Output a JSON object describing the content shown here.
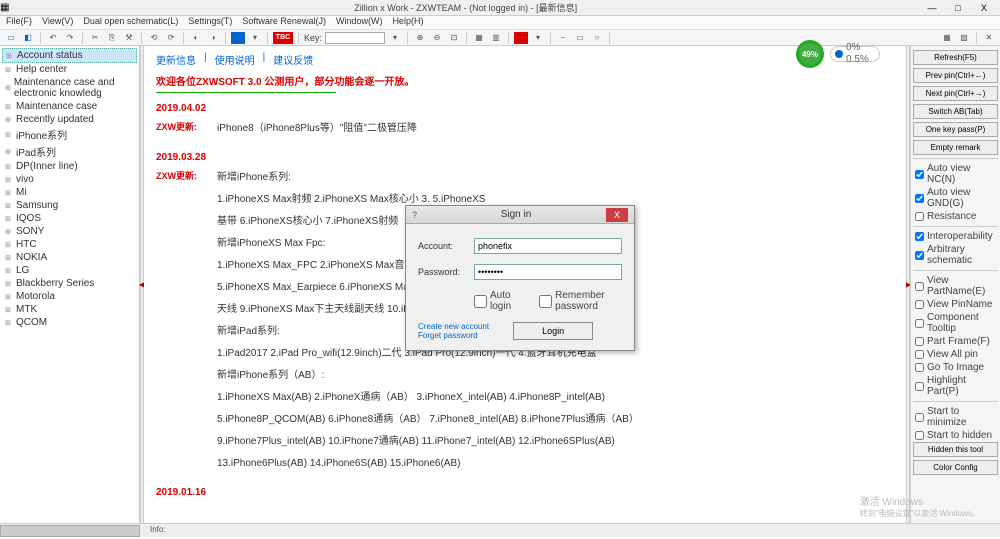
{
  "window": {
    "title": "Zillion x Work - ZXWTEAM - (Not logged in) - [最新信息]",
    "min": "—",
    "max": "□",
    "close": "X"
  },
  "menubar": [
    "File(F)",
    "View(V)",
    "Dual open schematic(L)",
    "Settings(T)",
    "Software Renewal(J)",
    "Window(W)",
    "Help(H)"
  ],
  "toolbar": {
    "key_label": "Key:",
    "tbc": "TBC"
  },
  "sidebar": {
    "items": [
      {
        "label": "Account status",
        "active": true
      },
      {
        "label": "Help center"
      },
      {
        "label": "Maintenance case and electronic knowledg"
      },
      {
        "label": "Maintenance case"
      },
      {
        "label": "Recently updated"
      },
      {
        "label": "iPhone系列"
      },
      {
        "label": "iPad系列"
      },
      {
        "label": "DP(Inner line)"
      },
      {
        "label": "vivo"
      },
      {
        "label": "Mi"
      },
      {
        "label": "Samsung"
      },
      {
        "label": "IQOS"
      },
      {
        "label": "SONY"
      },
      {
        "label": "HTC"
      },
      {
        "label": "NOKIA"
      },
      {
        "label": "LG"
      },
      {
        "label": "Blackberry Series"
      },
      {
        "label": "Motorola"
      },
      {
        "label": "MTK"
      },
      {
        "label": "QCOM"
      }
    ]
  },
  "content": {
    "tabs": [
      "更新信息",
      "使用说明",
      "建议反馈"
    ],
    "welcome": "欢迎各位ZXWSOFT 3.0 公测用户，部分功能会逐一开放。",
    "sections": [
      {
        "date": "2019.04.02",
        "label": "ZXW更新:",
        "lines": [
          "iPhone8（iPhone8Plus等）\"阻值\"二极管压降"
        ]
      },
      {
        "date": "2019.03.28",
        "label": "ZXW更新:",
        "lines": [
          "新增iPhone系列:",
          "1.iPhoneXS Max射频   2.iPhoneXS Max核心小   3.                        5.iPhoneXS",
          "基带    6.iPhoneXS核心小   7.iPhoneXS射频",
          "",
          "新增iPhoneXS Max Fpc:",
          "1.iPhoneXS Max_FPC   2.iPhoneXS Max音量排线   3.                   4.iPhoneXS Max前摄",
          "   5.iPhoneXS Max_Earpiece   6.iPhoneXS Max",
          "天线    9.iPhoneXS Max下主天线副天线   10.iP",
          "",
          "新增iPad系列:",
          "1.iPad2017    2.iPad Pro_wifi(12.9inch)二代   3.iPad Pro(12.9inch)一代    4.蓝牙耳机充电盒",
          "",
          "新增iPhone系列（AB）:",
          "1.iPhoneXS Max(AB) 2.iPhoneX通病（AB）   3.iPhoneX_intel(AB)   4.iPhone8P_intel(AB)",
          "5.iPhone8P_QCOM(AB)    6.iPhone8通病（AB）   7.iPhone8_intel(AB)   8.iPhone7Plus通病（AB）",
          "9.iPhone7Plus_intel(AB)   10.iPhone7通病(AB)   11.iPhone7_intel(AB)   12.iPhone6SPlus(AB)",
          "13.iPhone6Plus(AB)    14.iPhone6S(AB)   15.iPhone6(AB)"
        ]
      },
      {
        "date": "2019.01.16",
        "label": "",
        "lines": []
      }
    ]
  },
  "rightbar": {
    "buttons1": [
      "Refresh(F5)",
      "Prev pin(Ctrl+←)",
      "Next pin(Ctrl+→)",
      "Switch AB(Tab)",
      "One key pass(P)",
      "Empty remark"
    ],
    "checks1": [
      {
        "label": "Auto view NC(N)",
        "checked": true
      },
      {
        "label": "Auto view GND(G)",
        "checked": true
      },
      {
        "label": "Resistance",
        "checked": false
      }
    ],
    "checks2": [
      {
        "label": "Interoperability",
        "checked": true
      },
      {
        "label": "Arbitrary schematic",
        "checked": true
      }
    ],
    "checks3": [
      {
        "label": "View PartName(E)",
        "checked": false
      },
      {
        "label": "View PinName",
        "checked": false
      },
      {
        "label": "Component Tooltip",
        "checked": false
      },
      {
        "label": "Part Frame(F)",
        "checked": false
      },
      {
        "label": "View All pin",
        "checked": false
      },
      {
        "label": "Go To Image",
        "checked": false
      },
      {
        "label": "Highlight Part(P)",
        "checked": false
      }
    ],
    "checks4": [
      {
        "label": "Start to minimize",
        "checked": false
      },
      {
        "label": "Start to hidden",
        "checked": false
      }
    ],
    "buttons2": [
      "Hidden this tool",
      "Color Config"
    ]
  },
  "dialog": {
    "title": "Sign in",
    "account_label": "Account:",
    "account_value": "phonefix",
    "password_label": "Password:",
    "password_value": "••••••••",
    "auto_login": "Auto login",
    "remember": "Remember password",
    "create": "Create new account",
    "forget": "Forget password",
    "login": "Login"
  },
  "badge": {
    "percent": "49%",
    "cpu": "0%",
    "mem": "0.5%"
  },
  "statusbar": {
    "info": "Info:"
  },
  "watermark": {
    "line1": "激活 Windows",
    "line2": "转到\"电脑设置\"以激活 Windows。"
  }
}
